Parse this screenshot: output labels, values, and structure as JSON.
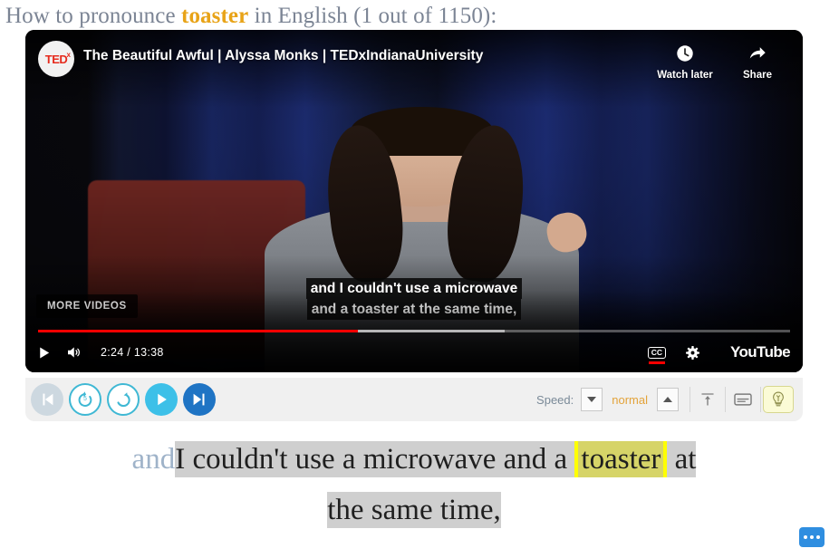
{
  "page": {
    "title_prefix": "How to pronounce ",
    "title_word": "toaster",
    "title_suffix": " in English (1 out of 1150):"
  },
  "video": {
    "channel_logo": "tedx-logo",
    "logo_text": "TED",
    "logo_superscript": "x",
    "title": "The Beautiful Awful | Alyssa Monks | TEDxIndianaUniversity",
    "actions": [
      {
        "label": "Watch later",
        "icon": "clock-icon"
      },
      {
        "label": "Share",
        "icon": "share-arrow-icon"
      }
    ],
    "more_videos_label": "MORE VIDEOS",
    "subtitles": [
      "and I couldn't use a microwave",
      "and a toaster at the same time,"
    ],
    "controls": {
      "play_icon": "play-icon",
      "volume_icon": "volume-icon",
      "time": "2:24 / 13:38",
      "current_time": "2:24",
      "duration": "13:38",
      "cc_label": "CC",
      "settings_icon": "gear-icon",
      "brand": "YouTube",
      "progress_percent": 42.5,
      "buffered_percent": 62
    }
  },
  "toolbar": {
    "buttons": [
      {
        "name": "previous-phrase-button",
        "icon": "skip-back-icon",
        "state": "disabled"
      },
      {
        "name": "rewind-5s-button",
        "icon": "rewind-5-icon",
        "state": "outline"
      },
      {
        "name": "repeat-button",
        "icon": "repeat-icon",
        "state": "outline"
      },
      {
        "name": "play-button",
        "icon": "play-icon",
        "state": "fill-light"
      },
      {
        "name": "next-phrase-button",
        "icon": "skip-forward-icon",
        "state": "fill-dark"
      }
    ],
    "speed": {
      "label": "Speed:",
      "value": "normal",
      "decrease_icon": "chevron-down-icon",
      "increase_icon": "chevron-up-icon"
    },
    "right_icons": [
      {
        "name": "scroll-to-top-button",
        "icon": "arrow-up-to-bar-icon",
        "active": false
      },
      {
        "name": "toggle-subtitles-button",
        "icon": "caption-box-icon",
        "active": false
      },
      {
        "name": "hint-button",
        "icon": "lightbulb-icon",
        "active": true
      }
    ]
  },
  "transcript": {
    "previous_word": "and",
    "line1_before": "I couldn't use a microwave and a ",
    "highlight_word": "toaster",
    "line1_after": " at",
    "line2": "the same time,"
  },
  "corner": {
    "badge_icon": "more-options-icon"
  },
  "colors": {
    "title_text": "#7b8494",
    "accent_word": "#e8a317",
    "youtube_red": "#ff0000",
    "speed_value": "#e3a33a",
    "highlight_yellow": "#d6d468",
    "highlight_border": "#ffff00",
    "transcript_highlight": "#cfcfcf",
    "badge_blue": "#2f8ee0"
  }
}
